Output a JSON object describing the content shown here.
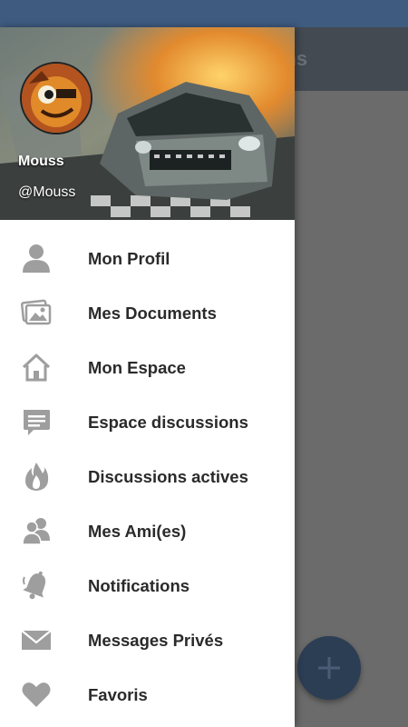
{
  "app_bar": {
    "title": "ons"
  },
  "header": {
    "name": "Mouss",
    "handle": "@Mouss"
  },
  "menu": {
    "items": [
      {
        "label": "Mon Profil",
        "icon": "person-icon"
      },
      {
        "label": "Mes Documents",
        "icon": "photos-icon"
      },
      {
        "label": "Mon Espace",
        "icon": "home-icon"
      },
      {
        "label": "Espace discussions",
        "icon": "chat-bubble-icon"
      },
      {
        "label": "Discussions actives",
        "icon": "flame-icon"
      },
      {
        "label": "Mes Ami(es)",
        "icon": "friends-icon"
      },
      {
        "label": "Notifications",
        "icon": "bell-icon"
      },
      {
        "label": "Messages Privés",
        "icon": "envelope-icon"
      },
      {
        "label": "Favoris",
        "icon": "heart-icon"
      }
    ]
  },
  "colors": {
    "status_bar": "#3f5b80",
    "app_bar": "#434a52",
    "fab": "#2c3e54",
    "icon_gray": "#9e9e9e",
    "label": "#2a2a2a"
  }
}
